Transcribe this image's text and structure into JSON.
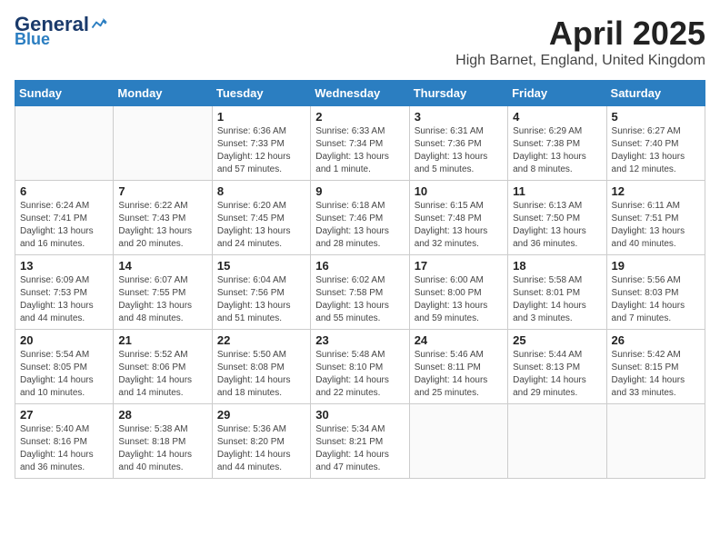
{
  "header": {
    "logo_general": "General",
    "logo_blue": "Blue",
    "month_title": "April 2025",
    "location": "High Barnet, England, United Kingdom"
  },
  "days_of_week": [
    "Sunday",
    "Monday",
    "Tuesday",
    "Wednesday",
    "Thursday",
    "Friday",
    "Saturday"
  ],
  "weeks": [
    [
      {
        "day": "",
        "info": ""
      },
      {
        "day": "",
        "info": ""
      },
      {
        "day": "1",
        "info": "Sunrise: 6:36 AM\nSunset: 7:33 PM\nDaylight: 12 hours and 57 minutes."
      },
      {
        "day": "2",
        "info": "Sunrise: 6:33 AM\nSunset: 7:34 PM\nDaylight: 13 hours and 1 minute."
      },
      {
        "day": "3",
        "info": "Sunrise: 6:31 AM\nSunset: 7:36 PM\nDaylight: 13 hours and 5 minutes."
      },
      {
        "day": "4",
        "info": "Sunrise: 6:29 AM\nSunset: 7:38 PM\nDaylight: 13 hours and 8 minutes."
      },
      {
        "day": "5",
        "info": "Sunrise: 6:27 AM\nSunset: 7:40 PM\nDaylight: 13 hours and 12 minutes."
      }
    ],
    [
      {
        "day": "6",
        "info": "Sunrise: 6:24 AM\nSunset: 7:41 PM\nDaylight: 13 hours and 16 minutes."
      },
      {
        "day": "7",
        "info": "Sunrise: 6:22 AM\nSunset: 7:43 PM\nDaylight: 13 hours and 20 minutes."
      },
      {
        "day": "8",
        "info": "Sunrise: 6:20 AM\nSunset: 7:45 PM\nDaylight: 13 hours and 24 minutes."
      },
      {
        "day": "9",
        "info": "Sunrise: 6:18 AM\nSunset: 7:46 PM\nDaylight: 13 hours and 28 minutes."
      },
      {
        "day": "10",
        "info": "Sunrise: 6:15 AM\nSunset: 7:48 PM\nDaylight: 13 hours and 32 minutes."
      },
      {
        "day": "11",
        "info": "Sunrise: 6:13 AM\nSunset: 7:50 PM\nDaylight: 13 hours and 36 minutes."
      },
      {
        "day": "12",
        "info": "Sunrise: 6:11 AM\nSunset: 7:51 PM\nDaylight: 13 hours and 40 minutes."
      }
    ],
    [
      {
        "day": "13",
        "info": "Sunrise: 6:09 AM\nSunset: 7:53 PM\nDaylight: 13 hours and 44 minutes."
      },
      {
        "day": "14",
        "info": "Sunrise: 6:07 AM\nSunset: 7:55 PM\nDaylight: 13 hours and 48 minutes."
      },
      {
        "day": "15",
        "info": "Sunrise: 6:04 AM\nSunset: 7:56 PM\nDaylight: 13 hours and 51 minutes."
      },
      {
        "day": "16",
        "info": "Sunrise: 6:02 AM\nSunset: 7:58 PM\nDaylight: 13 hours and 55 minutes."
      },
      {
        "day": "17",
        "info": "Sunrise: 6:00 AM\nSunset: 8:00 PM\nDaylight: 13 hours and 59 minutes."
      },
      {
        "day": "18",
        "info": "Sunrise: 5:58 AM\nSunset: 8:01 PM\nDaylight: 14 hours and 3 minutes."
      },
      {
        "day": "19",
        "info": "Sunrise: 5:56 AM\nSunset: 8:03 PM\nDaylight: 14 hours and 7 minutes."
      }
    ],
    [
      {
        "day": "20",
        "info": "Sunrise: 5:54 AM\nSunset: 8:05 PM\nDaylight: 14 hours and 10 minutes."
      },
      {
        "day": "21",
        "info": "Sunrise: 5:52 AM\nSunset: 8:06 PM\nDaylight: 14 hours and 14 minutes."
      },
      {
        "day": "22",
        "info": "Sunrise: 5:50 AM\nSunset: 8:08 PM\nDaylight: 14 hours and 18 minutes."
      },
      {
        "day": "23",
        "info": "Sunrise: 5:48 AM\nSunset: 8:10 PM\nDaylight: 14 hours and 22 minutes."
      },
      {
        "day": "24",
        "info": "Sunrise: 5:46 AM\nSunset: 8:11 PM\nDaylight: 14 hours and 25 minutes."
      },
      {
        "day": "25",
        "info": "Sunrise: 5:44 AM\nSunset: 8:13 PM\nDaylight: 14 hours and 29 minutes."
      },
      {
        "day": "26",
        "info": "Sunrise: 5:42 AM\nSunset: 8:15 PM\nDaylight: 14 hours and 33 minutes."
      }
    ],
    [
      {
        "day": "27",
        "info": "Sunrise: 5:40 AM\nSunset: 8:16 PM\nDaylight: 14 hours and 36 minutes."
      },
      {
        "day": "28",
        "info": "Sunrise: 5:38 AM\nSunset: 8:18 PM\nDaylight: 14 hours and 40 minutes."
      },
      {
        "day": "29",
        "info": "Sunrise: 5:36 AM\nSunset: 8:20 PM\nDaylight: 14 hours and 44 minutes."
      },
      {
        "day": "30",
        "info": "Sunrise: 5:34 AM\nSunset: 8:21 PM\nDaylight: 14 hours and 47 minutes."
      },
      {
        "day": "",
        "info": ""
      },
      {
        "day": "",
        "info": ""
      },
      {
        "day": "",
        "info": ""
      }
    ]
  ]
}
